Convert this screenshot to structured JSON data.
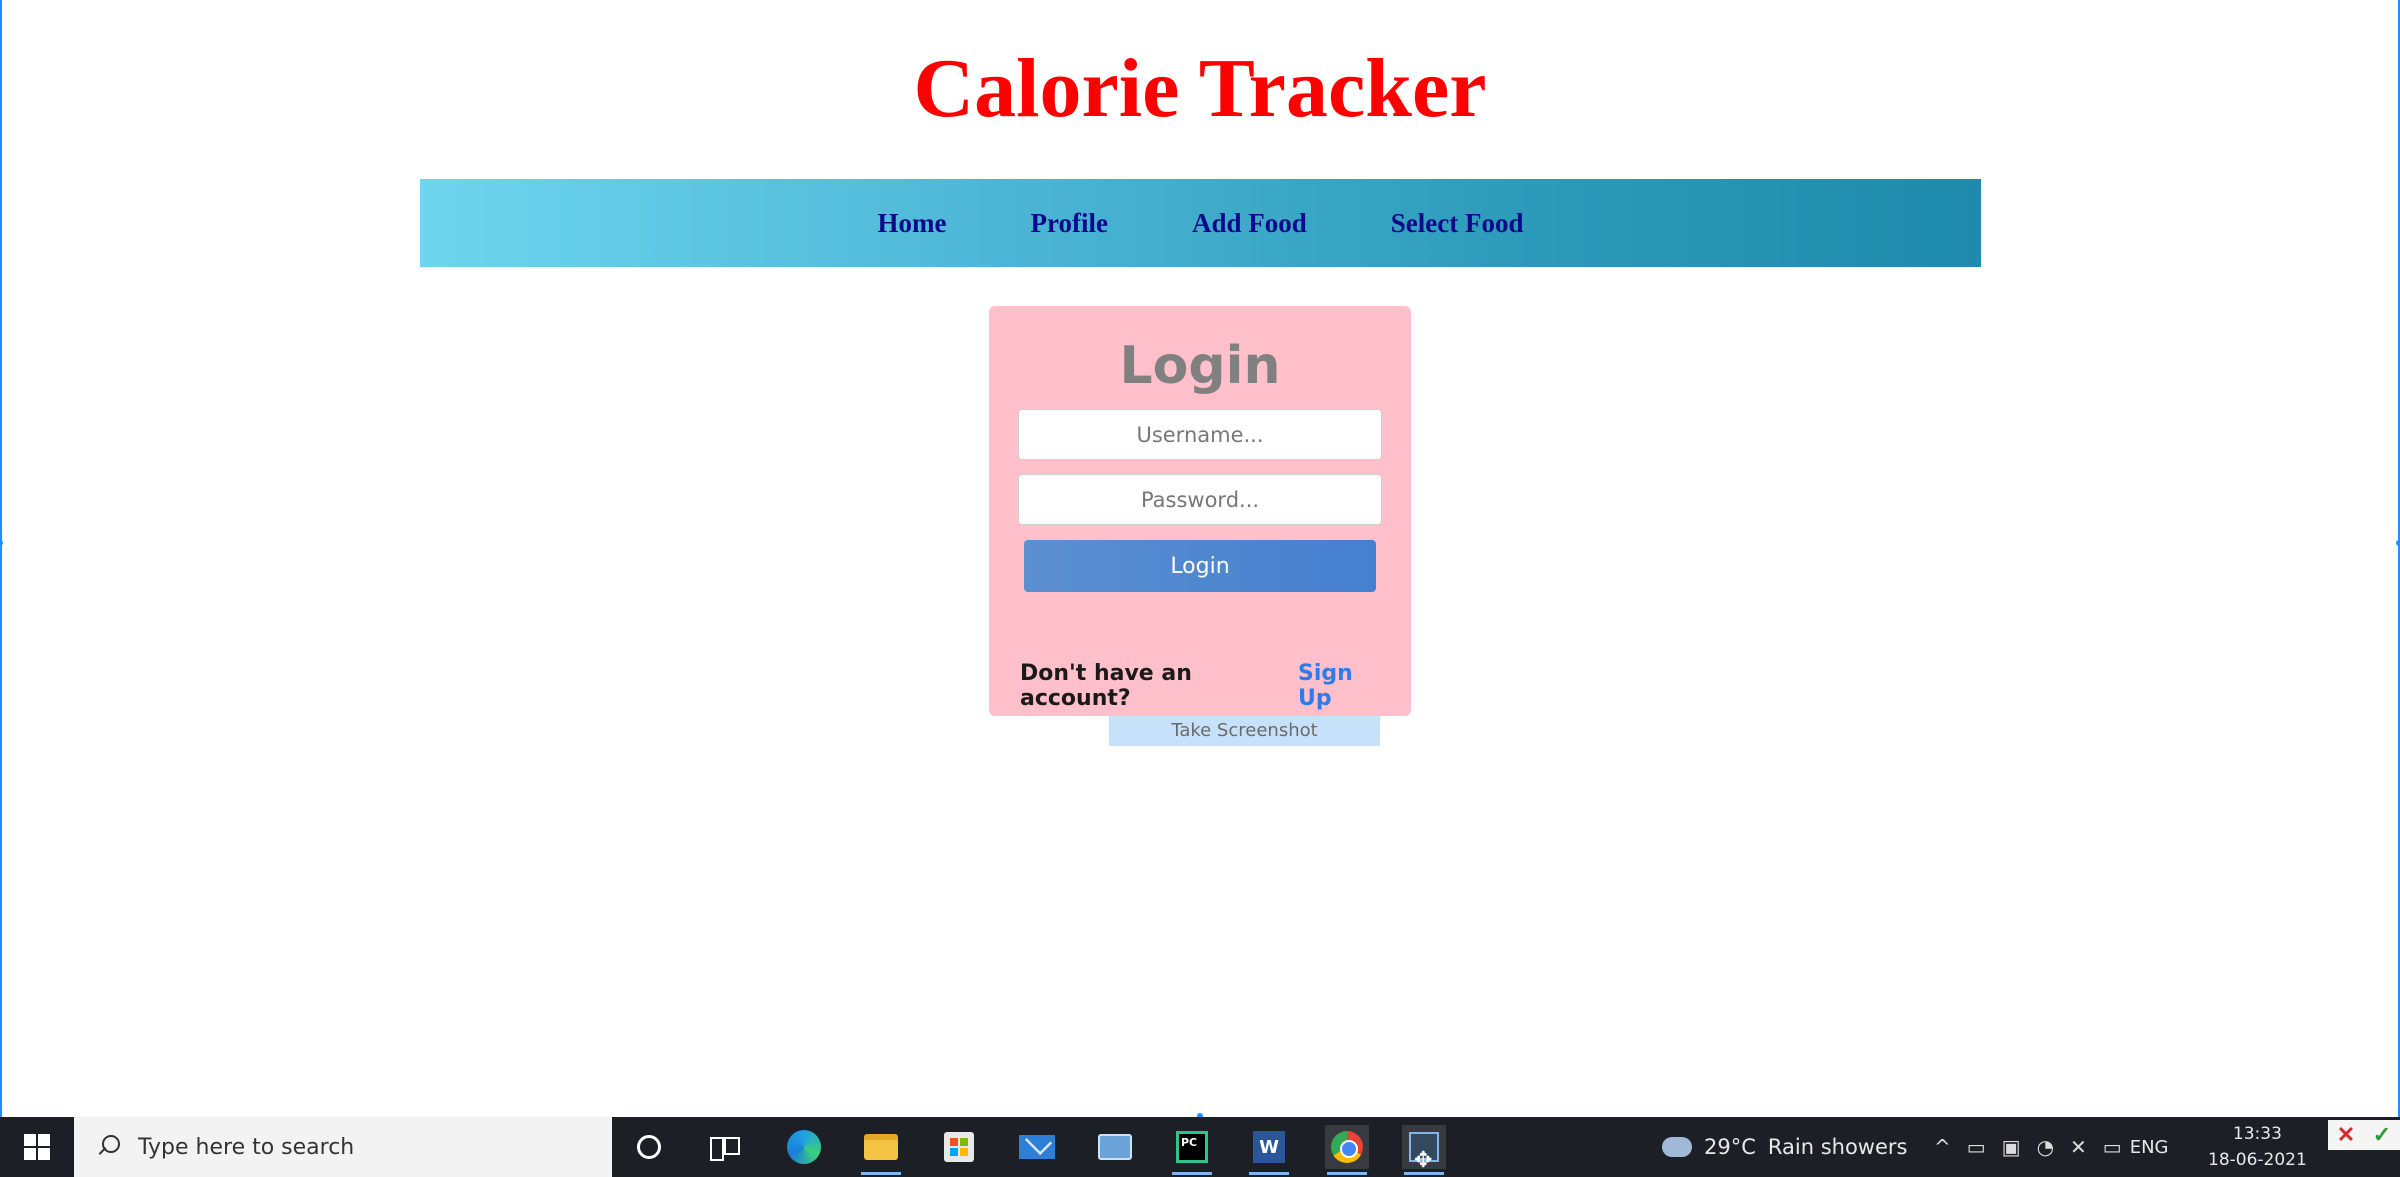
{
  "app": {
    "title": "Calorie Tracker"
  },
  "nav": {
    "items": [
      {
        "label": "Home"
      },
      {
        "label": "Profile"
      },
      {
        "label": "Add Food"
      },
      {
        "label": "Select Food"
      }
    ],
    "gradient_colors": [
      "#6dd5ed",
      "#1f8aab"
    ]
  },
  "login": {
    "heading": "Login",
    "username_placeholder": "Username...",
    "password_placeholder": "Password...",
    "button_label": "Login",
    "signup_prompt": "Don't have an account?",
    "signup_link": "Sign Up",
    "card_color": "#ffc0cb"
  },
  "screenshot_tool": {
    "label": "Take Screenshot"
  },
  "taskbar": {
    "search_placeholder": "Type here to search",
    "apps": [
      "cortana-icon",
      "task-view-icon",
      "edge-icon",
      "file-explorer-icon",
      "store-icon",
      "mail-icon",
      "cards-icon",
      "pycharm-icon",
      "word-icon",
      "chrome-icon",
      "snipping-tool-icon"
    ],
    "pycharm_badge": "PC",
    "word_badge": "W",
    "weather": {
      "temperature": "29°C",
      "condition": "Rain showers"
    },
    "language": "ENG",
    "clock": {
      "time": "13:33",
      "date": "18-06-2021"
    }
  },
  "colors": {
    "title": "#ff0000",
    "nav_text": "#0a0a8a",
    "link": "#2f7be8",
    "taskbar": "#1c2026"
  }
}
